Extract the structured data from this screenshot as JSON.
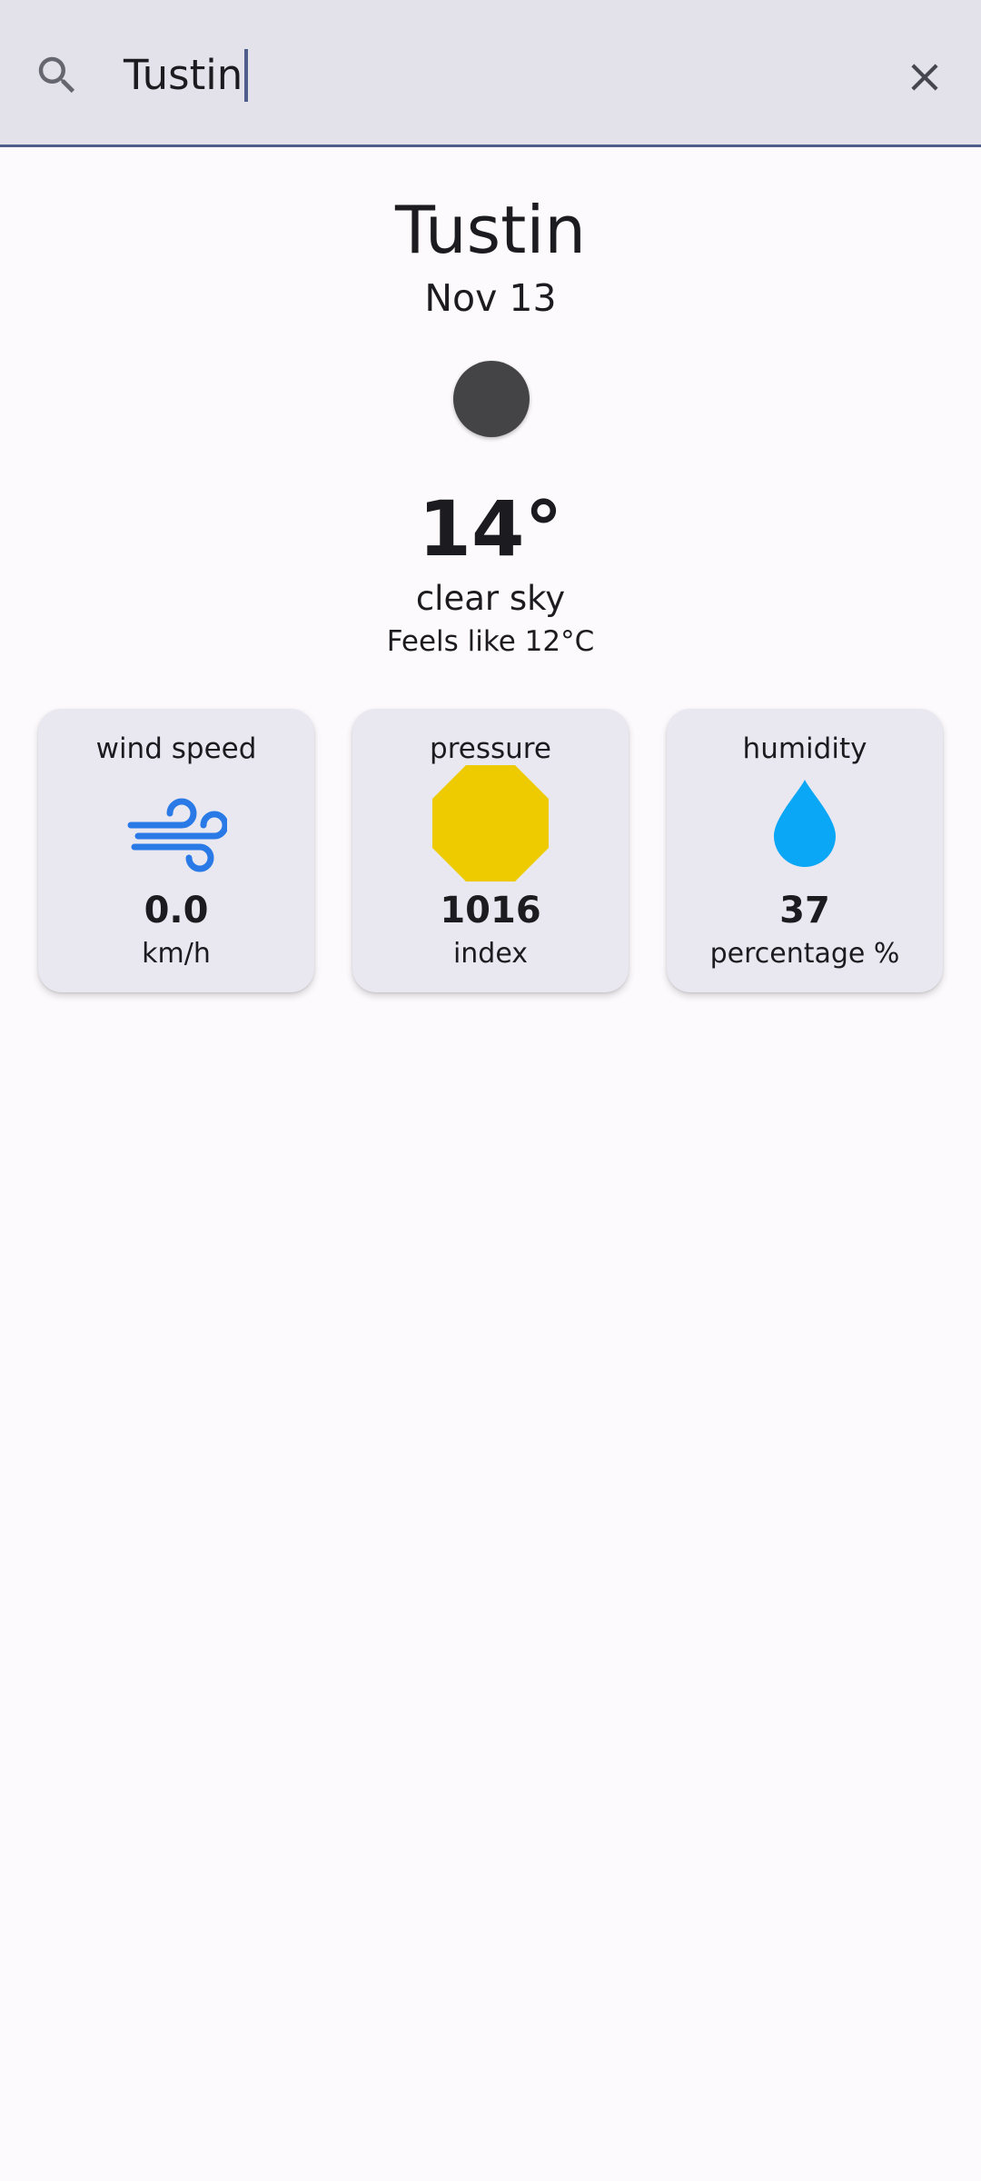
{
  "search": {
    "value": "Tustin",
    "icon": "search-icon",
    "clear_icon": "close-icon"
  },
  "weather": {
    "city": "Tustin",
    "date": "Nov 13",
    "condition_icon": "clear-sky-icon",
    "temperature": "14°",
    "description": "clear sky",
    "feels_like": "Feels like 12°C"
  },
  "cards": [
    {
      "title": "wind speed",
      "icon": "wind-icon",
      "value": "0.0",
      "unit": "km/h",
      "icon_color": "#2979e6"
    },
    {
      "title": "pressure",
      "icon": "pressure-icon",
      "value": "1016",
      "unit": "index",
      "icon_color": "#eecb00"
    },
    {
      "title": "humidity",
      "icon": "water-drop-icon",
      "value": "37",
      "unit": "percentage %",
      "icon_color": "#0aa7f6"
    }
  ],
  "colors": {
    "background": "#fcfafd",
    "search_bar": "#e3e1ea",
    "accent": "#4e5d8a",
    "card": "#e9e8f0",
    "text": "#1c1b1f"
  }
}
